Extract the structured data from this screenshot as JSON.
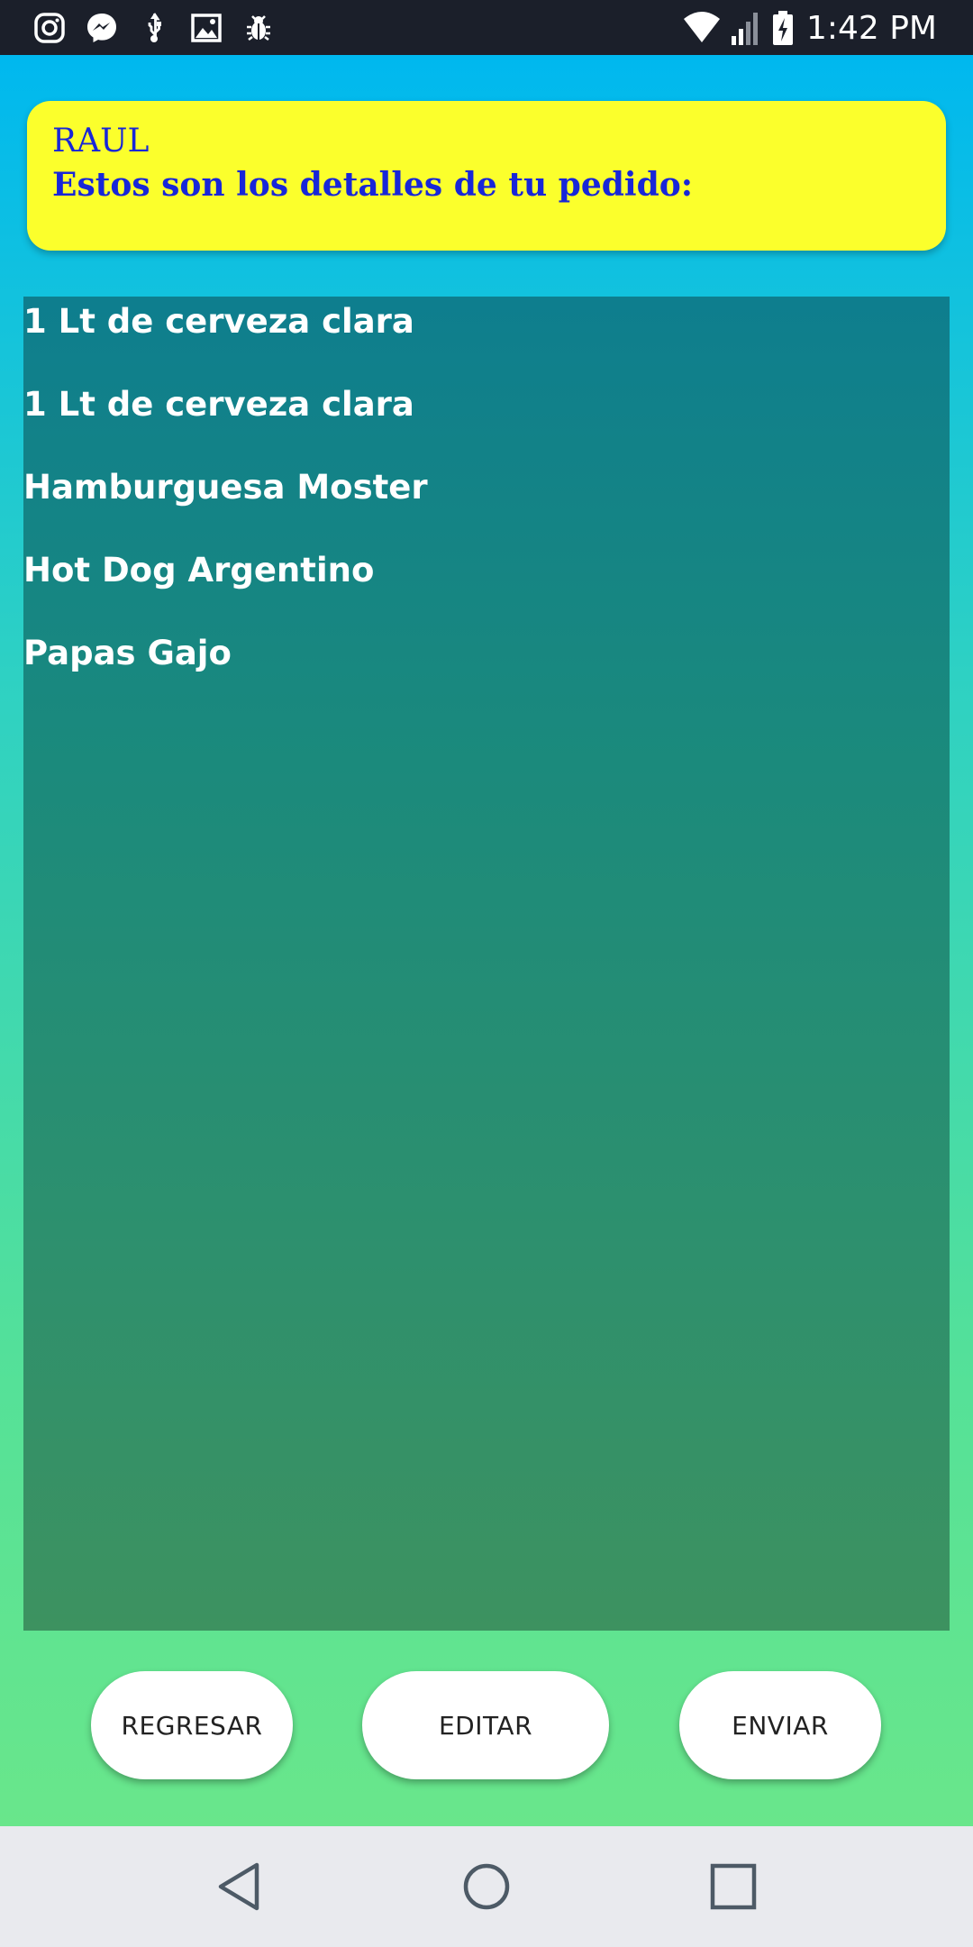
{
  "status_bar": {
    "time": "1:42 PM",
    "left_icons": [
      "instagram-icon",
      "messenger-icon",
      "usb-icon",
      "image-icon",
      "debug-bug-icon"
    ],
    "right_icons": [
      "wifi-icon",
      "cell-signal-icon",
      "battery-charging-icon"
    ]
  },
  "header": {
    "name": "RAUL",
    "subtitle": "Estos son los detalles de tu pedido:"
  },
  "order_items": [
    "1 Lt de cerveza clara",
    "1 Lt de cerveza clara",
    "Hamburguesa Moster",
    "Hot Dog Argentino",
    "Papas Gajo"
  ],
  "buttons": {
    "back_label": "REGRESAR",
    "edit_label": "EDITAR",
    "send_label": "ENVIAR"
  },
  "nav_bar": {
    "icons": [
      "back-triangle-icon",
      "home-circle-icon",
      "recents-square-icon"
    ]
  },
  "colors": {
    "header_card_bg": "#fbff2c",
    "header_text": "#1826d8",
    "gradient_top": "#00b8ef",
    "gradient_bottom": "#69e68b",
    "list_bg_top": "#0e7e8e",
    "list_bg_bottom": "#3d9260"
  }
}
